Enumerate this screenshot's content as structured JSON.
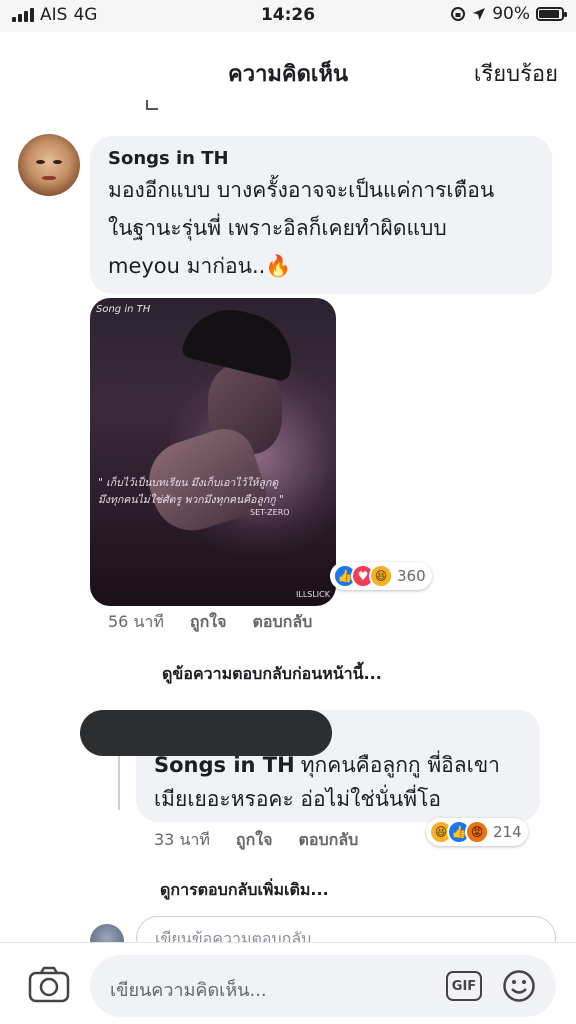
{
  "status_bar": {
    "carrier": "AIS",
    "network": "4G",
    "time": "14:26",
    "battery": "90%",
    "battery_level": 0.9
  },
  "nav": {
    "title": "ความคิดเห็น",
    "done_label": "เรียบร้อย"
  },
  "comment": {
    "author": "Songs in TH",
    "text_line1": "มองอีกแบบ บางครั้งอาจจะเป็นแค่การเตือน",
    "text_line2": "ในฐานะรุ่นพี่ เพราะอิลก็เคยทำผิดแบบ",
    "text_line3": "meyou มาก่อน..🔥",
    "photo": {
      "label_top_left": "Song in TH",
      "quote_line1": "\" เก็บไว้เป็นบทเรียน มึงเก็บเอาไว้ให้ลูกดู",
      "quote_line2": "มึงทุกคนไม่ใช่ศัตรู พวกมึงทุกคนคือลูกกู \"",
      "quote_author": "SET-ZERO",
      "label_bottom_right": "ILLSLICK"
    },
    "reactions": {
      "icons": [
        "like-icon",
        "love-icon",
        "haha-icon"
      ],
      "count": "360"
    },
    "time": "56 นาที",
    "like_label": "ถูกใจ",
    "reply_label": "ตอบกลับ"
  },
  "view_previous_replies": "ดูข้อความตอบกลับก่อนหน้านี้...",
  "reply": {
    "author": "Songs in TH",
    "text_line1": "ทุกคนคือลูกกู พี่อิลเขา",
    "text_line2": "เมียเยอะหรอคะ อ่อไม่ใช่นั่นพี่โอ",
    "reactions": {
      "icons": [
        "haha-icon",
        "like-icon",
        "angry-icon"
      ],
      "count": "214"
    },
    "time": "33 นาที",
    "like_label": "ถูกใจ",
    "reply_label": "ตอบกลับ"
  },
  "view_more_replies": "ดูการตอบกลับเพิ่มเติม...",
  "reply_input_placeholder": "เขียนข้อความตอบกลับ...",
  "composer": {
    "placeholder": "เขียนความคิดเห็น...",
    "gif_label": "GIF"
  },
  "colors": {
    "like": "#1877f2",
    "love": "#f33e58",
    "haha": "#f7b125",
    "angry": "#e9710f",
    "bubble": "#f0f2f5"
  }
}
